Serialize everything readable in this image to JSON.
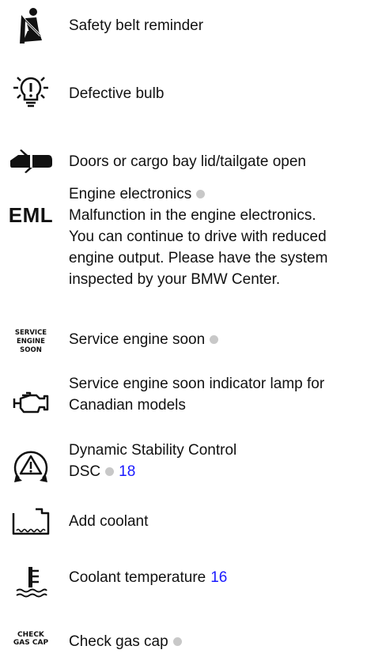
{
  "entries": [
    {
      "icon": "seatbelt-icon",
      "title": "Safety belt reminder"
    },
    {
      "icon": "defective-bulb-icon",
      "title": "Defective bulb"
    },
    {
      "icon": "door-open-icon",
      "title": "Doors or cargo bay lid/tailgate open"
    },
    {
      "icon": "eml-icon",
      "icon_text": "EML",
      "title": "Engine electronics",
      "description_lines": [
        "Malfunction in the engine electronics.",
        "You can continue to drive with reduced",
        "engine output. Please have the system",
        "inspected by your BMW Center."
      ]
    },
    {
      "icon": "service-engine-soon-icon",
      "icon_text_lines": [
        "SERVICE",
        "ENGINE",
        "SOON"
      ],
      "title": "Service engine soon"
    },
    {
      "icon": "engine-check-icon",
      "title_lines": [
        "Service engine soon indicator lamp for",
        "Canadian models"
      ]
    },
    {
      "icon": "dsc-warning-icon",
      "title": "Dynamic Stability Control",
      "subtitle": "DSC",
      "page_ref": "18"
    },
    {
      "icon": "coolant-reservoir-icon",
      "title": "Add coolant"
    },
    {
      "icon": "coolant-temperature-icon",
      "title": "Coolant temperature",
      "page_ref": "16"
    },
    {
      "icon": "check-gas-cap-icon",
      "icon_text_lines": [
        "CHECK",
        "GAS CAP"
      ],
      "title": "Check gas cap"
    }
  ],
  "colors": {
    "text": "#111111",
    "dot": "#c8c8c8",
    "link": "#1a1aff"
  }
}
